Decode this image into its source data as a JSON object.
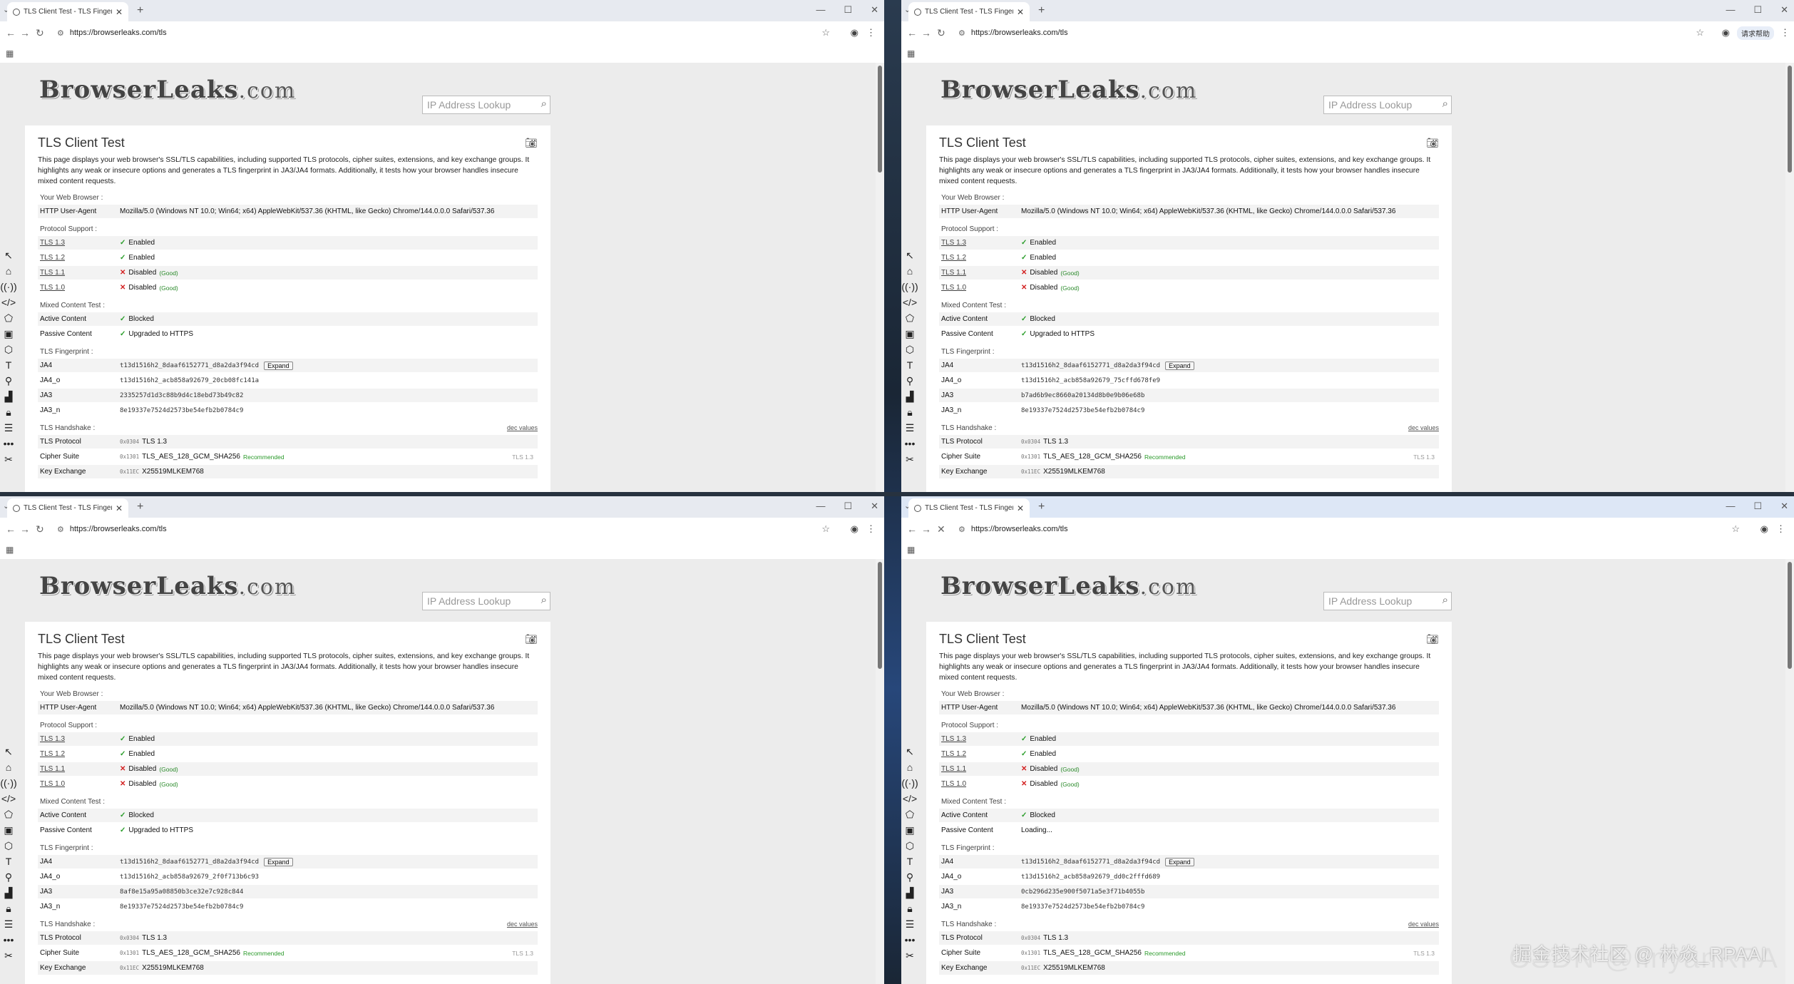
{
  "browser": {
    "tab_title": "TLS Client Test - TLS Fingerpr",
    "url": "https://browserleaks.com/tls",
    "extra_button": "请求帮助"
  },
  "site": {
    "logo": "BrowserLeaks",
    "logo_tld": ".com",
    "ip_lookup_placeholder": "IP Address Lookup",
    "title": "TLS Client Test",
    "intro": "This page displays your web browser's SSL/TLS capabilities, including supported TLS protocols, cipher suites, extensions, and key exchange groups. It highlights any weak or insecure options and generates a TLS fingerprint in JA3/JA4 formats. Additionally, it tests how your browser handles insecure mixed content requests.",
    "sections": {
      "browser": "Your Web Browser :",
      "protocol": "Protocol Support :",
      "mixed": "Mixed Content Test :",
      "fingerprint": "TLS Fingerprint :",
      "handshake": "TLS Handshake :",
      "dec_values": "dec values"
    },
    "labels": {
      "ua": "HTTP User-Agent",
      "tls13": "TLS 1.3",
      "tls12": "TLS 1.2",
      "tls11": "TLS 1.1",
      "tls10": "TLS 1.0",
      "active": "Active Content",
      "passive": "Passive Content",
      "ja4": "JA4",
      "ja4o": "JA4_o",
      "ja3": "JA3",
      "ja3n": "JA3_n",
      "protocol": "TLS Protocol",
      "cipher": "Cipher Suite",
      "kex": "Key Exchange"
    },
    "values": {
      "ua": "Mozilla/5.0 (Windows NT 10.0; Win64; x64) AppleWebKit/537.36 (KHTML, like Gecko) Chrome/144.0.0.0 Safari/537.36",
      "enabled": "Enabled",
      "disabled": "Disabled",
      "good": "(Good)",
      "blocked": "Blocked",
      "upgraded": "Upgraded to HTTPS",
      "loading": "Loading...",
      "expand": "Expand",
      "check": "✓",
      "cross": "✕",
      "proto_hex": "0x0304",
      "proto": "TLS 1.3",
      "cipher_hex": "0x1301",
      "cipher": "TLS_AES_128_GCM_SHA256",
      "recommended": "Recommended",
      "cipher_ver": "TLS 1.3",
      "kex_hex": "0x11EC",
      "kex": "X25519MLKEM768",
      "ja3n": "8e19337e7524d2573be54efb2b0784c9"
    }
  },
  "panes": {
    "tl": {
      "ja4": "t13d1516h2_8daaf6152771_d8a2da3f94cd",
      "ja4o": "t13d1516h2_acb858a92679_20cb08fc141a",
      "ja3": "2335257d1d3c88b9d4c18ebd73b49c82",
      "passive_state": "upgraded"
    },
    "tr": {
      "ja4": "t13d1516h2_8daaf6152771_d8a2da3f94cd",
      "ja4o": "t13d1516h2_acb858a92679_75cffd678fe9",
      "ja3": "b7ad6b9ec8660a20134d8b0e9b06e68b",
      "passive_state": "upgraded"
    },
    "bl": {
      "ja4": "t13d1516h2_8daaf6152771_d8a2da3f94cd",
      "ja4o": "t13d1516h2_acb858a92679_2f0f713b6c93",
      "ja3": "8af8e15a95a08850b3ce32e7c928c844",
      "passive_state": "upgraded"
    },
    "br": {
      "ja4": "t13d1516h2_8daaf6152771_d8a2da3f94cd",
      "ja4o": "t13d1516h2_acb858a92679_dd0c2fffd689",
      "ja3": "0cb296d235e900f5071a5e3f71b4055b",
      "passive_state": "loading"
    }
  },
  "watermark": "CSDN @linyanRPA",
  "watermark_cn": "掘金技术社区 @ 林焱_RPAAI"
}
